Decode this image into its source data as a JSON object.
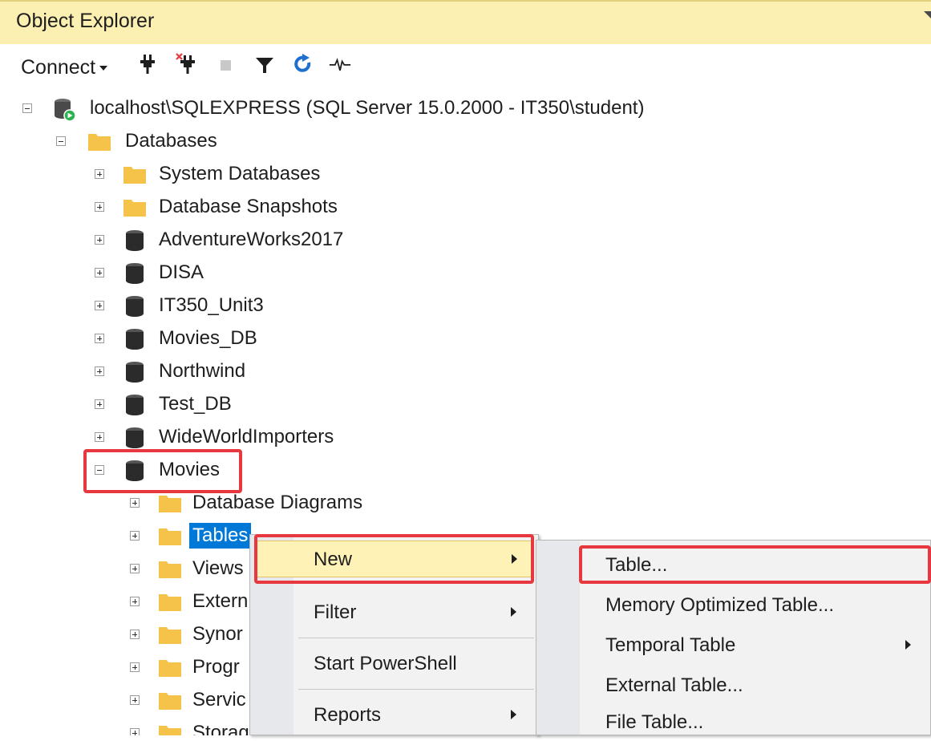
{
  "window": {
    "title": "Object Explorer"
  },
  "toolbar": {
    "connect_label": "Connect",
    "icons": [
      "connect-plug-icon",
      "disconnect-plug-icon",
      "stop-icon",
      "filter-icon",
      "refresh-icon",
      "activity-monitor-icon"
    ]
  },
  "tree": {
    "server": "localhost\\SQLEXPRESS (SQL Server 15.0.2000 - IT350\\student)",
    "databases_folder": "Databases",
    "databases": [
      {
        "label": "System Databases",
        "icon": "folder"
      },
      {
        "label": "Database Snapshots",
        "icon": "folder"
      },
      {
        "label": "AdventureWorks2017",
        "icon": "database"
      },
      {
        "label": "DISA",
        "icon": "database"
      },
      {
        "label": "IT350_Unit3",
        "icon": "database"
      },
      {
        "label": "Movies_DB",
        "icon": "database"
      },
      {
        "label": "Northwind",
        "icon": "database"
      },
      {
        "label": "Test_DB",
        "icon": "database"
      },
      {
        "label": "WideWorldImporters",
        "icon": "database"
      },
      {
        "label": "Movies",
        "icon": "database"
      }
    ],
    "movies_children": [
      {
        "label": "Database Diagrams"
      },
      {
        "label": "Tables",
        "selected": true
      },
      {
        "label": "Views"
      },
      {
        "label": "Extern"
      },
      {
        "label": "Synor"
      },
      {
        "label": "Progr"
      },
      {
        "label": "Servic"
      },
      {
        "label": "Storag"
      }
    ]
  },
  "context_menu": {
    "items": [
      {
        "label": "New",
        "has_submenu": true,
        "highlighted": true
      },
      {
        "label": "Filter",
        "has_submenu": true
      },
      {
        "label": "Start PowerShell",
        "has_submenu": false
      },
      {
        "label": "Reports",
        "has_submenu": true
      }
    ]
  },
  "submenu": {
    "items": [
      {
        "label": "Table...",
        "has_submenu": false
      },
      {
        "label": "Memory Optimized Table...",
        "has_submenu": false
      },
      {
        "label": "Temporal Table",
        "has_submenu": true
      },
      {
        "label": "External Table...",
        "has_submenu": false
      },
      {
        "label": "File Table...",
        "has_submenu": false
      }
    ]
  },
  "colors": {
    "titlebar": "#fbf0b2",
    "selection": "#0078d7",
    "menu_highlight": "#fff2b6",
    "annotation_red": "#e8383f",
    "folder": "#f5c34a",
    "database": "#2b2b2b"
  }
}
